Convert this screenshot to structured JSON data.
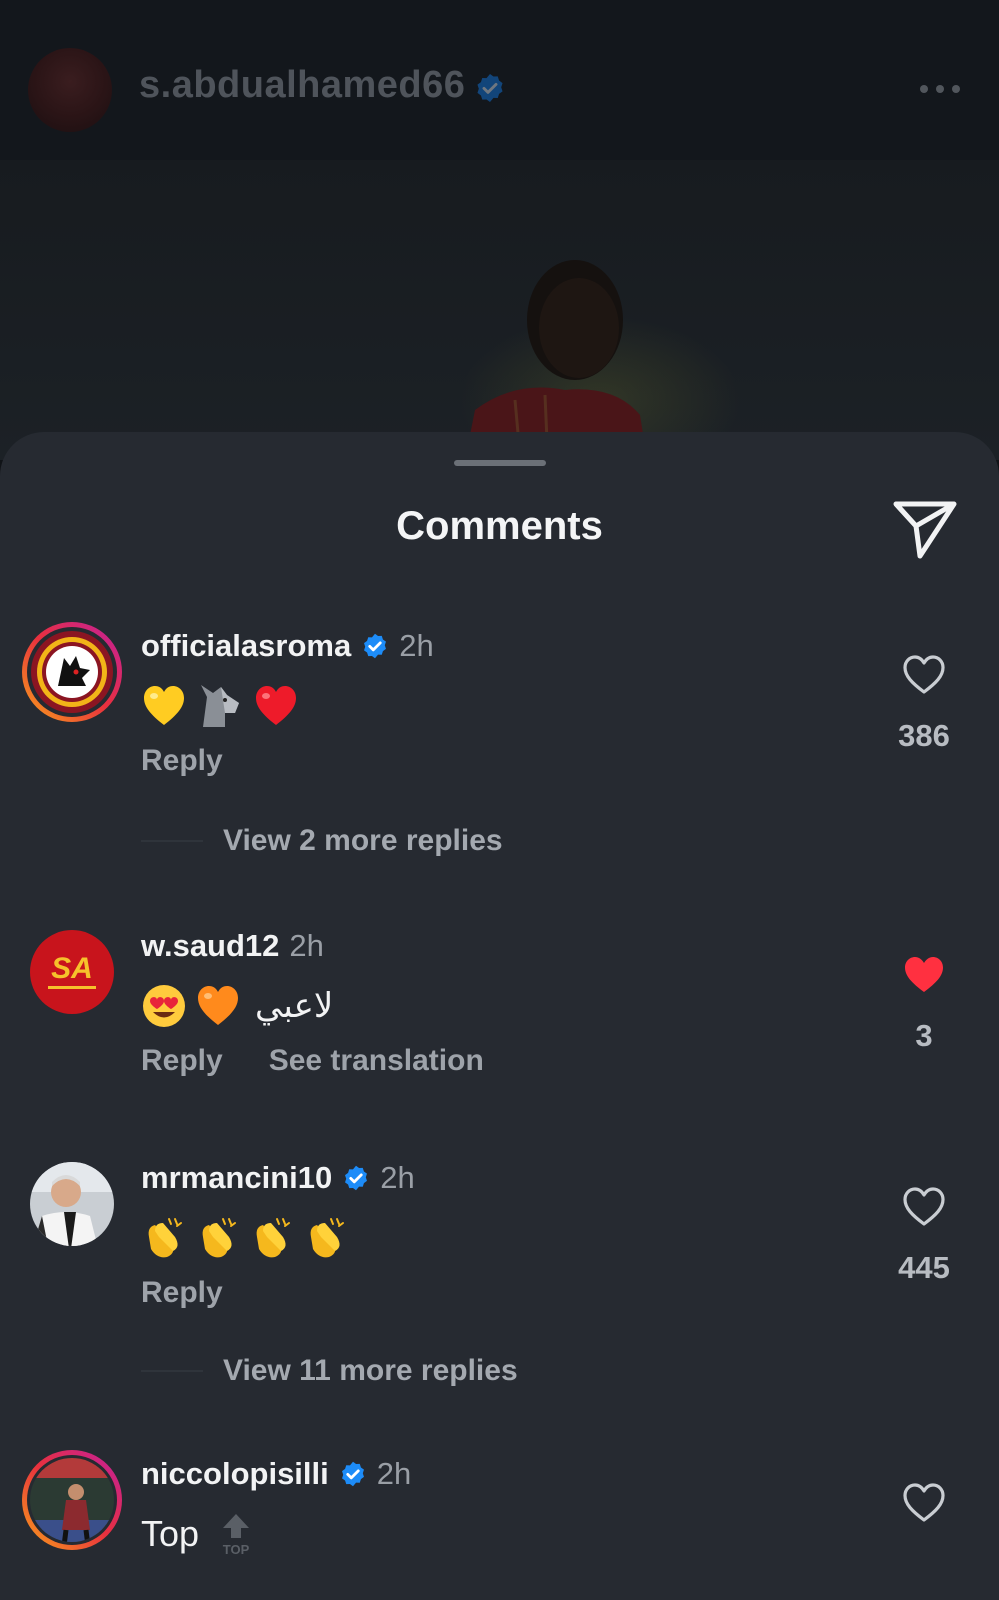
{
  "post": {
    "username": "s.abdualhamed66",
    "verified": true
  },
  "sheet": {
    "title": "Comments"
  },
  "comments": [
    {
      "username": "officialasroma",
      "verified": true,
      "time": "2h",
      "text_emojis": [
        "yellow-heart",
        "wolf",
        "red-heart"
      ],
      "reply_label": "Reply",
      "likes": "386",
      "liked": false,
      "view_replies": "View 2 more replies"
    },
    {
      "username": "w.saud12",
      "verified": false,
      "time": "2h",
      "text_emojis": [
        "heart-eyes",
        "orange-heart"
      ],
      "text": "لاعبي",
      "reply_label": "Reply",
      "translation_label": "See translation",
      "likes": "3",
      "liked": true
    },
    {
      "username": "mrmancini10",
      "verified": true,
      "time": "2h",
      "text_emojis": [
        "clapping-hands",
        "clapping-hands",
        "clapping-hands",
        "clapping-hands"
      ],
      "reply_label": "Reply",
      "likes": "445",
      "liked": false,
      "view_replies": "View 11 more replies"
    },
    {
      "username": "niccolopisilli",
      "verified": true,
      "time": "2h",
      "text": "Top",
      "text_emojis": [
        "top-arrow"
      ],
      "liked": false
    }
  ],
  "colors": {
    "sheet_bg": "#262a31",
    "verified_blue": "#1d8cf8",
    "like_red": "#ff3040"
  }
}
